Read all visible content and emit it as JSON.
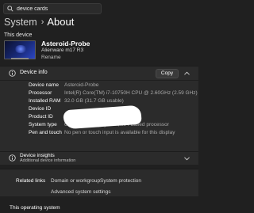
{
  "search": {
    "value": "device cards",
    "icon": "search-icon"
  },
  "breadcrumb": {
    "parent": "System",
    "separator": "›",
    "current": "About"
  },
  "this_device": {
    "section_label": "This device",
    "name": "Asteroid-Probe",
    "model": "Alienware m17 R3",
    "rename_label": "Rename"
  },
  "device_info": {
    "title": "Device info",
    "copy_label": "Copy",
    "rows": [
      {
        "label": "Device name",
        "value": "Asteroid-Probe"
      },
      {
        "label": "Processor",
        "value": "Intel(R) Core(TM) i7-10750H CPU @ 2.60GHz (2.59 GHz)"
      },
      {
        "label": "Installed RAM",
        "value": "32.0 GB (31.7 GB usable)"
      },
      {
        "label": "Device ID",
        "value": ""
      },
      {
        "label": "Product ID",
        "value": ""
      },
      {
        "label": "System type",
        "value": "64-bit operating system, x64-based processor"
      },
      {
        "label": "Pen and touch",
        "value": "No pen or touch input is available for this display"
      }
    ]
  },
  "device_insights": {
    "title": "Device insights",
    "subtitle": "Additional device information"
  },
  "related": {
    "label": "Related links",
    "links": [
      "Domain or workgroup",
      "System protection",
      "Advanced system settings"
    ]
  },
  "footer": {
    "section_label": "This operating system"
  },
  "colors": {
    "background": "#202020",
    "panel": "#2b2b2b",
    "text": "#ffffff",
    "muted": "#a9a9a9"
  }
}
